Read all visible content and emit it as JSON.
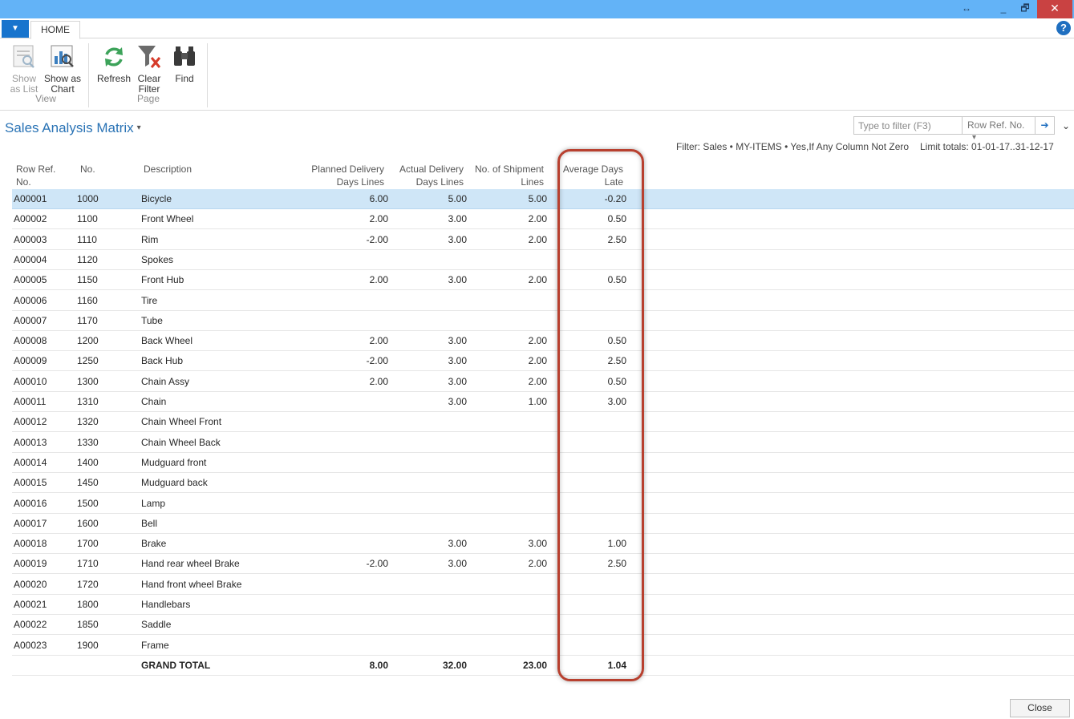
{
  "window": {
    "restore_glyph": "↔",
    "minimize_glyph": "_",
    "maximize_glyph": "🗗",
    "close_glyph": "✕"
  },
  "ribbon": {
    "app_menu_glyph": "▼",
    "tab": "HOME",
    "help_glyph": "?",
    "groups": {
      "view": {
        "label": "View",
        "show_as_list": "Show as List",
        "show_as_chart": "Show as Chart"
      },
      "page": {
        "label": "Page",
        "refresh": "Refresh",
        "clear_filter": "Clear Filter",
        "find": "Find"
      }
    }
  },
  "page": {
    "title": "Sales Analysis Matrix",
    "title_caret": "▾",
    "filter_placeholder": "Type to filter (F3)",
    "filter_field": "Row Ref. No.",
    "filter_field_caret": "▾",
    "filter_go": "➔",
    "collapse_glyph": "⌄",
    "filter_info": "Filter: Sales • MY-ITEMS • Yes,If Any Column Not Zero",
    "limit_info": "Limit totals: 01-01-17..31-12-17"
  },
  "columns": {
    "ref": [
      "Row Ref.",
      "No."
    ],
    "no": "No.",
    "desc": "Description",
    "planned": [
      "Planned Delivery",
      "Days Lines"
    ],
    "actual": [
      "Actual Delivery",
      "Days Lines"
    ],
    "ship": [
      "No. of Shipment",
      "Lines"
    ],
    "avg": [
      "Average Days",
      "Late"
    ]
  },
  "rows": [
    {
      "ref": "A00001",
      "no": "1000",
      "desc": "Bicycle",
      "planned": "6.00",
      "actual": "5.00",
      "ship": "5.00",
      "avg": "-0.20"
    },
    {
      "ref": "A00002",
      "no": "1100",
      "desc": "Front Wheel",
      "planned": "2.00",
      "actual": "3.00",
      "ship": "2.00",
      "avg": "0.50"
    },
    {
      "ref": "A00003",
      "no": "1110",
      "desc": "Rim",
      "planned": "-2.00",
      "actual": "3.00",
      "ship": "2.00",
      "avg": "2.50"
    },
    {
      "ref": "A00004",
      "no": "1120",
      "desc": "Spokes",
      "planned": "",
      "actual": "",
      "ship": "",
      "avg": ""
    },
    {
      "ref": "A00005",
      "no": "1150",
      "desc": "Front Hub",
      "planned": "2.00",
      "actual": "3.00",
      "ship": "2.00",
      "avg": "0.50"
    },
    {
      "ref": "A00006",
      "no": "1160",
      "desc": "Tire",
      "planned": "",
      "actual": "",
      "ship": "",
      "avg": ""
    },
    {
      "ref": "A00007",
      "no": "1170",
      "desc": "Tube",
      "planned": "",
      "actual": "",
      "ship": "",
      "avg": ""
    },
    {
      "ref": "A00008",
      "no": "1200",
      "desc": "Back Wheel",
      "planned": "2.00",
      "actual": "3.00",
      "ship": "2.00",
      "avg": "0.50"
    },
    {
      "ref": "A00009",
      "no": "1250",
      "desc": "Back Hub",
      "planned": "-2.00",
      "actual": "3.00",
      "ship": "2.00",
      "avg": "2.50"
    },
    {
      "ref": "A00010",
      "no": "1300",
      "desc": "Chain Assy",
      "planned": "2.00",
      "actual": "3.00",
      "ship": "2.00",
      "avg": "0.50"
    },
    {
      "ref": "A00011",
      "no": "1310",
      "desc": "Chain",
      "planned": "",
      "actual": "3.00",
      "ship": "1.00",
      "avg": "3.00"
    },
    {
      "ref": "A00012",
      "no": "1320",
      "desc": "Chain Wheel Front",
      "planned": "",
      "actual": "",
      "ship": "",
      "avg": ""
    },
    {
      "ref": "A00013",
      "no": "1330",
      "desc": "Chain Wheel Back",
      "planned": "",
      "actual": "",
      "ship": "",
      "avg": ""
    },
    {
      "ref": "A00014",
      "no": "1400",
      "desc": "Mudguard front",
      "planned": "",
      "actual": "",
      "ship": "",
      "avg": ""
    },
    {
      "ref": "A00015",
      "no": "1450",
      "desc": "Mudguard back",
      "planned": "",
      "actual": "",
      "ship": "",
      "avg": ""
    },
    {
      "ref": "A00016",
      "no": "1500",
      "desc": "Lamp",
      "planned": "",
      "actual": "",
      "ship": "",
      "avg": ""
    },
    {
      "ref": "A00017",
      "no": "1600",
      "desc": "Bell",
      "planned": "",
      "actual": "",
      "ship": "",
      "avg": ""
    },
    {
      "ref": "A00018",
      "no": "1700",
      "desc": "Brake",
      "planned": "",
      "actual": "3.00",
      "ship": "3.00",
      "avg": "1.00"
    },
    {
      "ref": "A00019",
      "no": "1710",
      "desc": "Hand rear wheel Brake",
      "planned": "-2.00",
      "actual": "3.00",
      "ship": "2.00",
      "avg": "2.50"
    },
    {
      "ref": "A00020",
      "no": "1720",
      "desc": "Hand front wheel Brake",
      "planned": "",
      "actual": "",
      "ship": "",
      "avg": ""
    },
    {
      "ref": "A00021",
      "no": "1800",
      "desc": "Handlebars",
      "planned": "",
      "actual": "",
      "ship": "",
      "avg": ""
    },
    {
      "ref": "A00022",
      "no": "1850",
      "desc": "Saddle",
      "planned": "",
      "actual": "",
      "ship": "",
      "avg": ""
    },
    {
      "ref": "A00023",
      "no": "1900",
      "desc": "Frame",
      "planned": "",
      "actual": "",
      "ship": "",
      "avg": ""
    }
  ],
  "total": {
    "ref": "",
    "no": "",
    "desc": "GRAND TOTAL",
    "planned": "8.00",
    "actual": "32.00",
    "ship": "23.00",
    "avg": "1.04"
  },
  "footer": {
    "close": "Close"
  },
  "colors": {
    "accent": "#2a73b5",
    "titlebar": "#63b3f7",
    "selected_row": "#cfe6f7",
    "highlight": "#b8402f"
  }
}
